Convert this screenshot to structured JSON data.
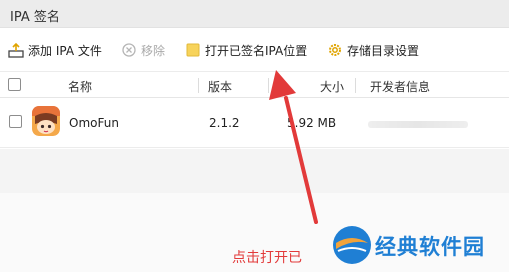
{
  "window": {
    "title": "IPA 签名"
  },
  "toolbar": {
    "add_label": "添加 IPA 文件",
    "remove_label": "移除",
    "open_label": "打开已签名IPA位置",
    "settings_label": "存储目录设置"
  },
  "table": {
    "columns": [
      "名称",
      "版本",
      "大小",
      "开发者信息"
    ],
    "rows": [
      {
        "name": "OmoFun",
        "version": "2.1.2",
        "size": "5.92 MB",
        "developer": ""
      }
    ]
  },
  "annotation": {
    "text": "点击打开已",
    "color": "#e23a3a"
  },
  "watermark": {
    "text": "经典软件园"
  },
  "colors": {
    "accent": "#1f7fd4",
    "folder": "#f5c842",
    "arrow": "#e23a3a"
  }
}
